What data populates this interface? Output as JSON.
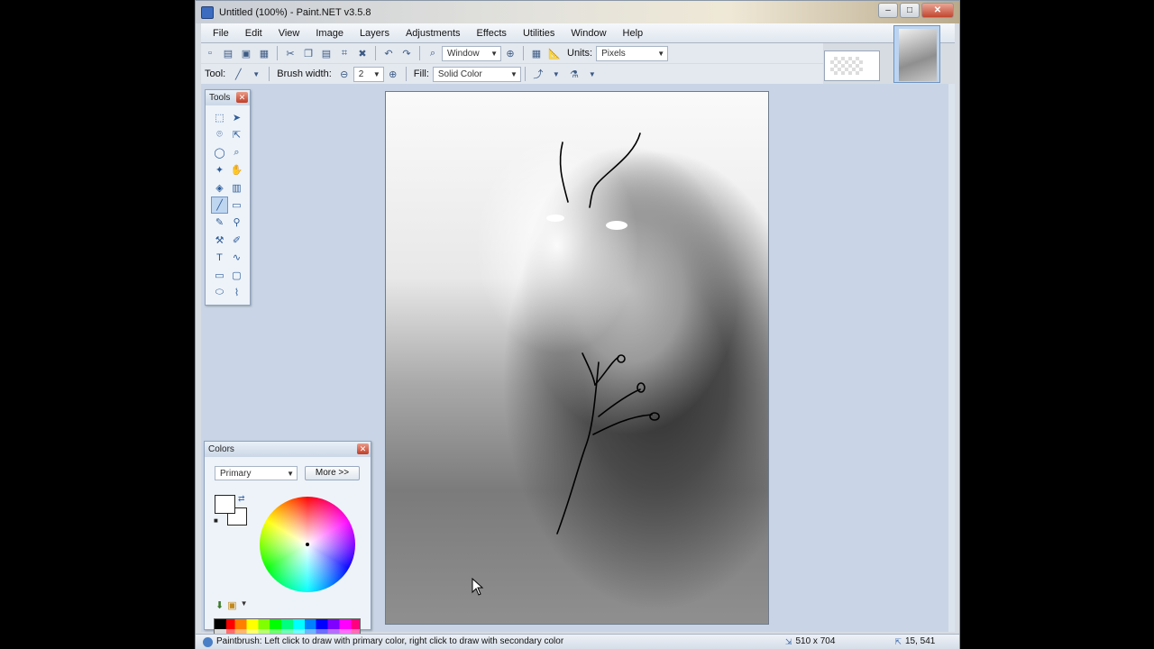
{
  "window": {
    "title": "Untitled (100%) - Paint.NET v3.5.8"
  },
  "menu": [
    "File",
    "Edit",
    "View",
    "Image",
    "Layers",
    "Adjustments",
    "Effects",
    "Utilities",
    "Window",
    "Help"
  ],
  "toolbar": {
    "zoom_mode": "Window",
    "units_label": "Units:",
    "units_value": "Pixels",
    "tool_label": "Tool:",
    "brush_width_label": "Brush width:",
    "brush_width_value": "2",
    "fill_label": "Fill:",
    "fill_value": "Solid Color"
  },
  "tools_panel": {
    "title": "Tools"
  },
  "colors_panel": {
    "title": "Colors",
    "mode": "Primary",
    "more_button": "More >>",
    "primary_color": "#ffffff",
    "secondary_color": "#ffffff"
  },
  "statusbar": {
    "hint": "Paintbrush: Left click to draw with primary color, right click to draw with secondary color",
    "image_size": "510 x 704",
    "cursor_position": "15, 541"
  },
  "colors": {
    "accent": "#3b6cbf",
    "canvas_bg": "#c9d5e6"
  }
}
